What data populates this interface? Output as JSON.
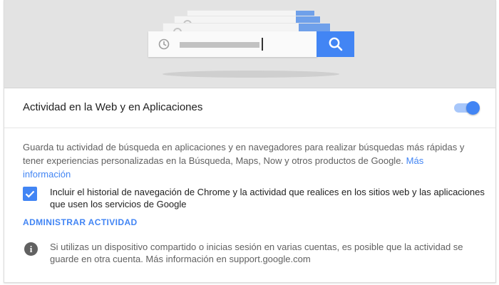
{
  "setting": {
    "title": "Actividad en la Web y en Aplicaciones",
    "toggle_on": true
  },
  "description": {
    "text": "Guarda tu actividad de búsqueda en aplicaciones y en navegadores para realizar búsquedas más rápidas y tener experiencias personalizadas en la Búsqueda, Maps, Now y otros productos de Google.",
    "link": "Más información"
  },
  "chrome_history": {
    "checked": true,
    "label": "Incluir el historial de navegación de Chrome y la actividad que realices en los sitios web y las aplicaciones que usen los servicios de Google"
  },
  "manage_link": "ADMINISTRAR ACTIVIDAD",
  "notice": {
    "text": "Si utilizas un dispositivo compartido o inicias sesión en varias cuentas, es posible que la actividad se guarde en otra cuenta. Más información en support.google.com"
  },
  "illustration": {
    "search_icon": "search-icon",
    "history_icon": "clock-icon"
  },
  "colors": {
    "accent": "#4285f4",
    "toggle_track": "#a8c7fa",
    "header_bg": "#e3e3e3"
  }
}
